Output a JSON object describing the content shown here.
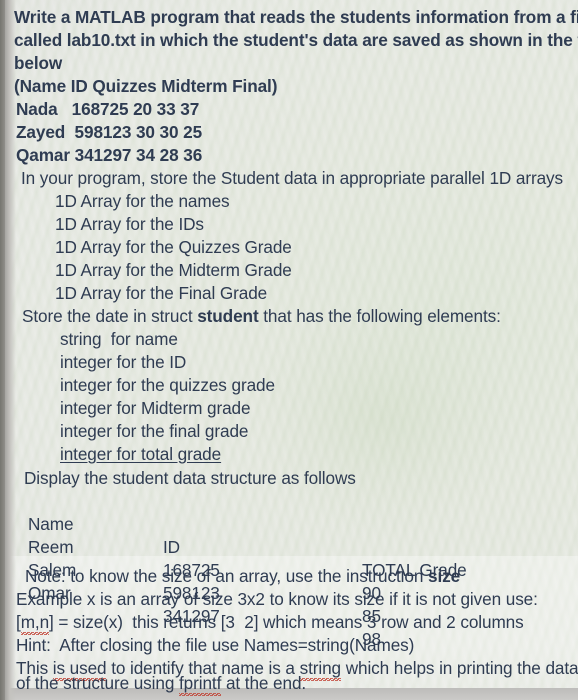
{
  "document": {
    "kind": "scanned-assignment-photo",
    "text_color": "#2f3c52",
    "paper_color": "#e7eae2",
    "intro": {
      "line1": "Write a MATLAB program that reads the students information from a file",
      "line2": "called lab10.txt in which the student's data are saved as shown in the format",
      "line3": "below"
    },
    "format_header": "(Name ID Quizzes Midterm Final)",
    "sample_records": [
      {
        "raw": "Nada   168725 20 33 37",
        "name": "Nada",
        "id": "168725",
        "quizzes": "20",
        "midterm": "33",
        "final": "37"
      },
      {
        "raw": "Zayed  598123 30 30 25",
        "name": "Zayed",
        "id": "598123",
        "quizzes": "30",
        "midterm": "30",
        "final": "25"
      },
      {
        "raw": "Qamar 341297 34 28 36",
        "name": "Qamar",
        "id": "341297",
        "quizzes": "34",
        "midterm": "28",
        "final": "36"
      }
    ],
    "arrays_instruction": "In your program, store the Student data in appropriate parallel 1D arrays",
    "arrays_list": [
      "1D Array for the names",
      "1D Array for the IDs",
      "1D Array for the Quizzes Grade",
      "1D Array for the Midterm Grade",
      "1D Array for the Final Grade"
    ],
    "struct_instruction": {
      "before": "Store the date in struct ",
      "bold": "student",
      "after": " that has the following elements:"
    },
    "struct_elements": [
      {
        "text": "string  for name",
        "underlined": false
      },
      {
        "text": "integer for the ID",
        "underlined": false
      },
      {
        "text": "integer for the quizzes grade",
        "underlined": false
      },
      {
        "text": "integer for Midterm grade",
        "underlined": false
      },
      {
        "text": "integer for the final grade",
        "underlined": false
      },
      {
        "text": "integer for total grade",
        "underlined": true
      }
    ],
    "display_instruction": "Display the student data structure as follows",
    "output_table": {
      "headers": [
        "Name",
        "ID",
        "TOTAL Grade"
      ],
      "rows": [
        [
          "Reem",
          "168725",
          "90"
        ],
        [
          "Salem",
          "598123",
          "85"
        ],
        [
          "Omar",
          "341297",
          "98"
        ]
      ]
    },
    "note": {
      "line1_before": "Note: to know the size of an array, use the instruction ",
      "line1_bold": "size",
      "line2": "Example x is an array of size 3x2 to know its size if it is not given use:",
      "line3_a": "[",
      "line3_misspelled": "m,n",
      "line3_b": "] = size(x)  this returns [3  2] which means 3 row and 2 columns"
    },
    "hint": {
      "line1": "Hint:  After closing the file use Names=string(Names)",
      "line2_a": "This ",
      "line2_misspelled1": "is used",
      "line2_b": " to identify that name is a ",
      "line2_misspelled2": "string",
      "line2_c": " which helps in printing the data",
      "line3_a": "of the structure using ",
      "line3_misspelled": "fprintf",
      "line3_b": " at the end."
    }
  }
}
